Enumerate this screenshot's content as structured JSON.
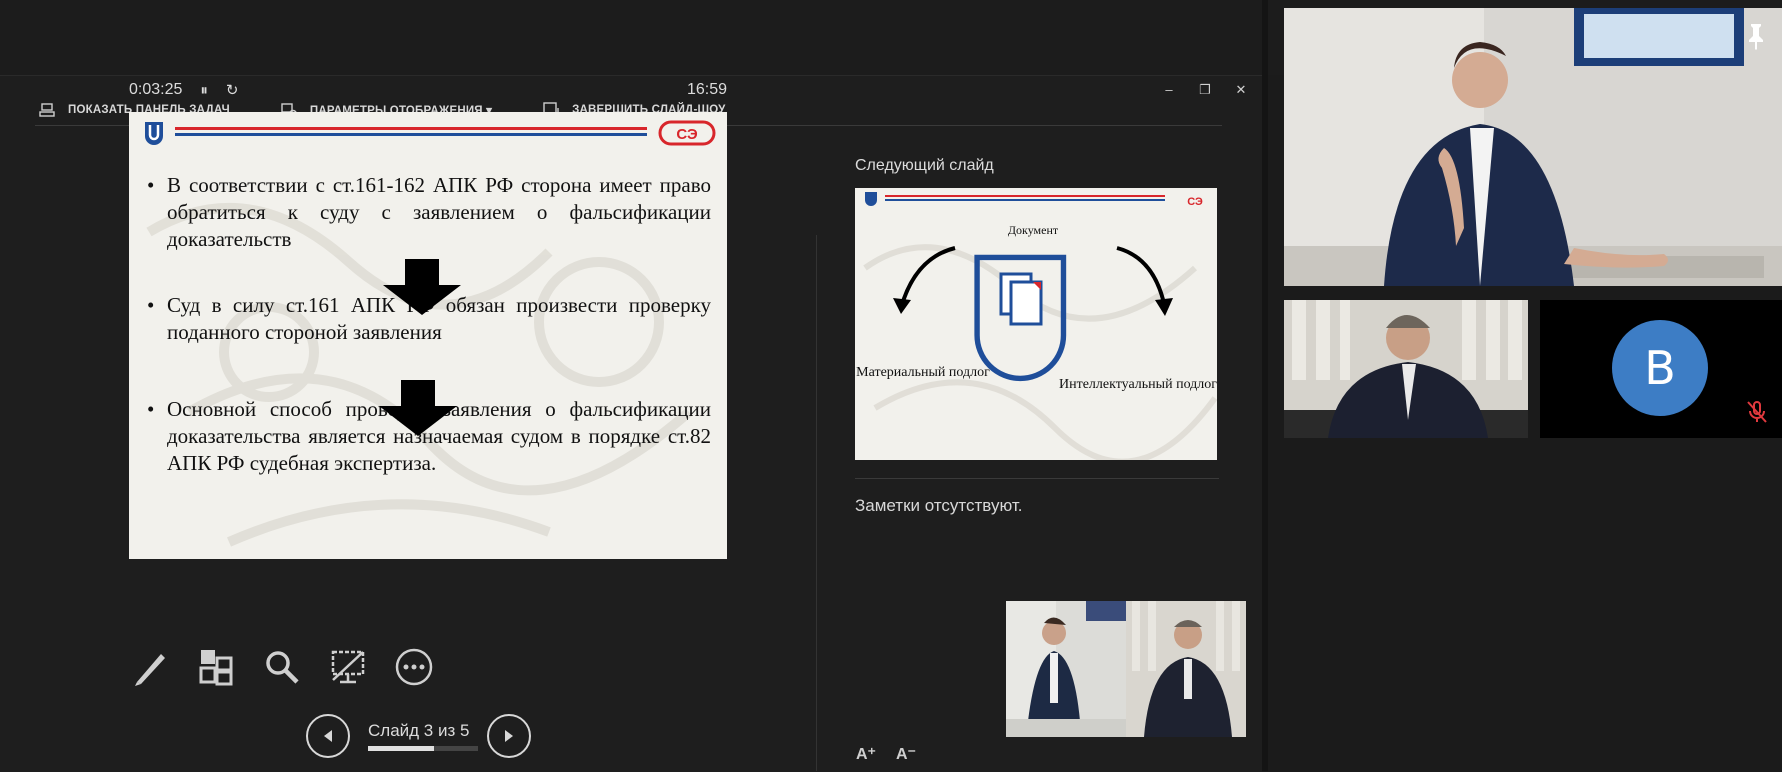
{
  "toolbar": {
    "show_taskbar": "ПОКАЗАТЬ ПАНЕЛЬ ЗАДАЧ",
    "display_settings": "ПАРАМЕТРЫ ОТОБРАЖЕНИЯ ▾",
    "end_show": "ЗАВЕРШИТЬ СЛАЙД-ШОУ"
  },
  "window_controls": {
    "minimize": "–",
    "restore": "❐",
    "close": "✕"
  },
  "timer": {
    "elapsed": "0:03:25",
    "pause_icon": "pause-icon",
    "reset_icon": "reset-icon",
    "clock": "16:59"
  },
  "current_slide": {
    "logo_right": "СЭ",
    "bullets": [
      "В соответствии с ст.161-162 АПК РФ сторона имеет право обратиться к суду с заявлением о фальсификации доказательств",
      "Суд в силу ст.161 АПК РФ обязан произвести проверку поданного стороной заявления",
      "Основной способ проверки заявления о фальсификации доказательства является назначаемая судом в порядке ст.82 АПК РФ судебная экспертиза."
    ]
  },
  "slide_tools": [
    "pen-icon",
    "all-slides-icon",
    "zoom-icon",
    "black-screen-icon",
    "more-options-icon"
  ],
  "navigation": {
    "label": "Слайд 3 из 5",
    "current": 3,
    "total": 5,
    "progress": 0.6
  },
  "next_slide": {
    "heading": "Следующий слайд",
    "logo_right": "СЭ",
    "top_label": "Документ",
    "left_label": "Материальный подлог",
    "right_label": "Интеллектуальный подлог"
  },
  "notes": {
    "text": "Заметки отсутствуют."
  },
  "font_buttons": {
    "increase": "A⁺",
    "decrease": "A⁻"
  },
  "participants": [
    {
      "role": "presenter",
      "pinned": true
    },
    {
      "role": "participant"
    },
    {
      "role": "participant",
      "avatar_letter": "B",
      "muted": true
    }
  ],
  "colors": {
    "accent_blue": "#1f4e9a",
    "accent_red": "#d8262b",
    "avatar_blue": "#3d7dc5"
  }
}
